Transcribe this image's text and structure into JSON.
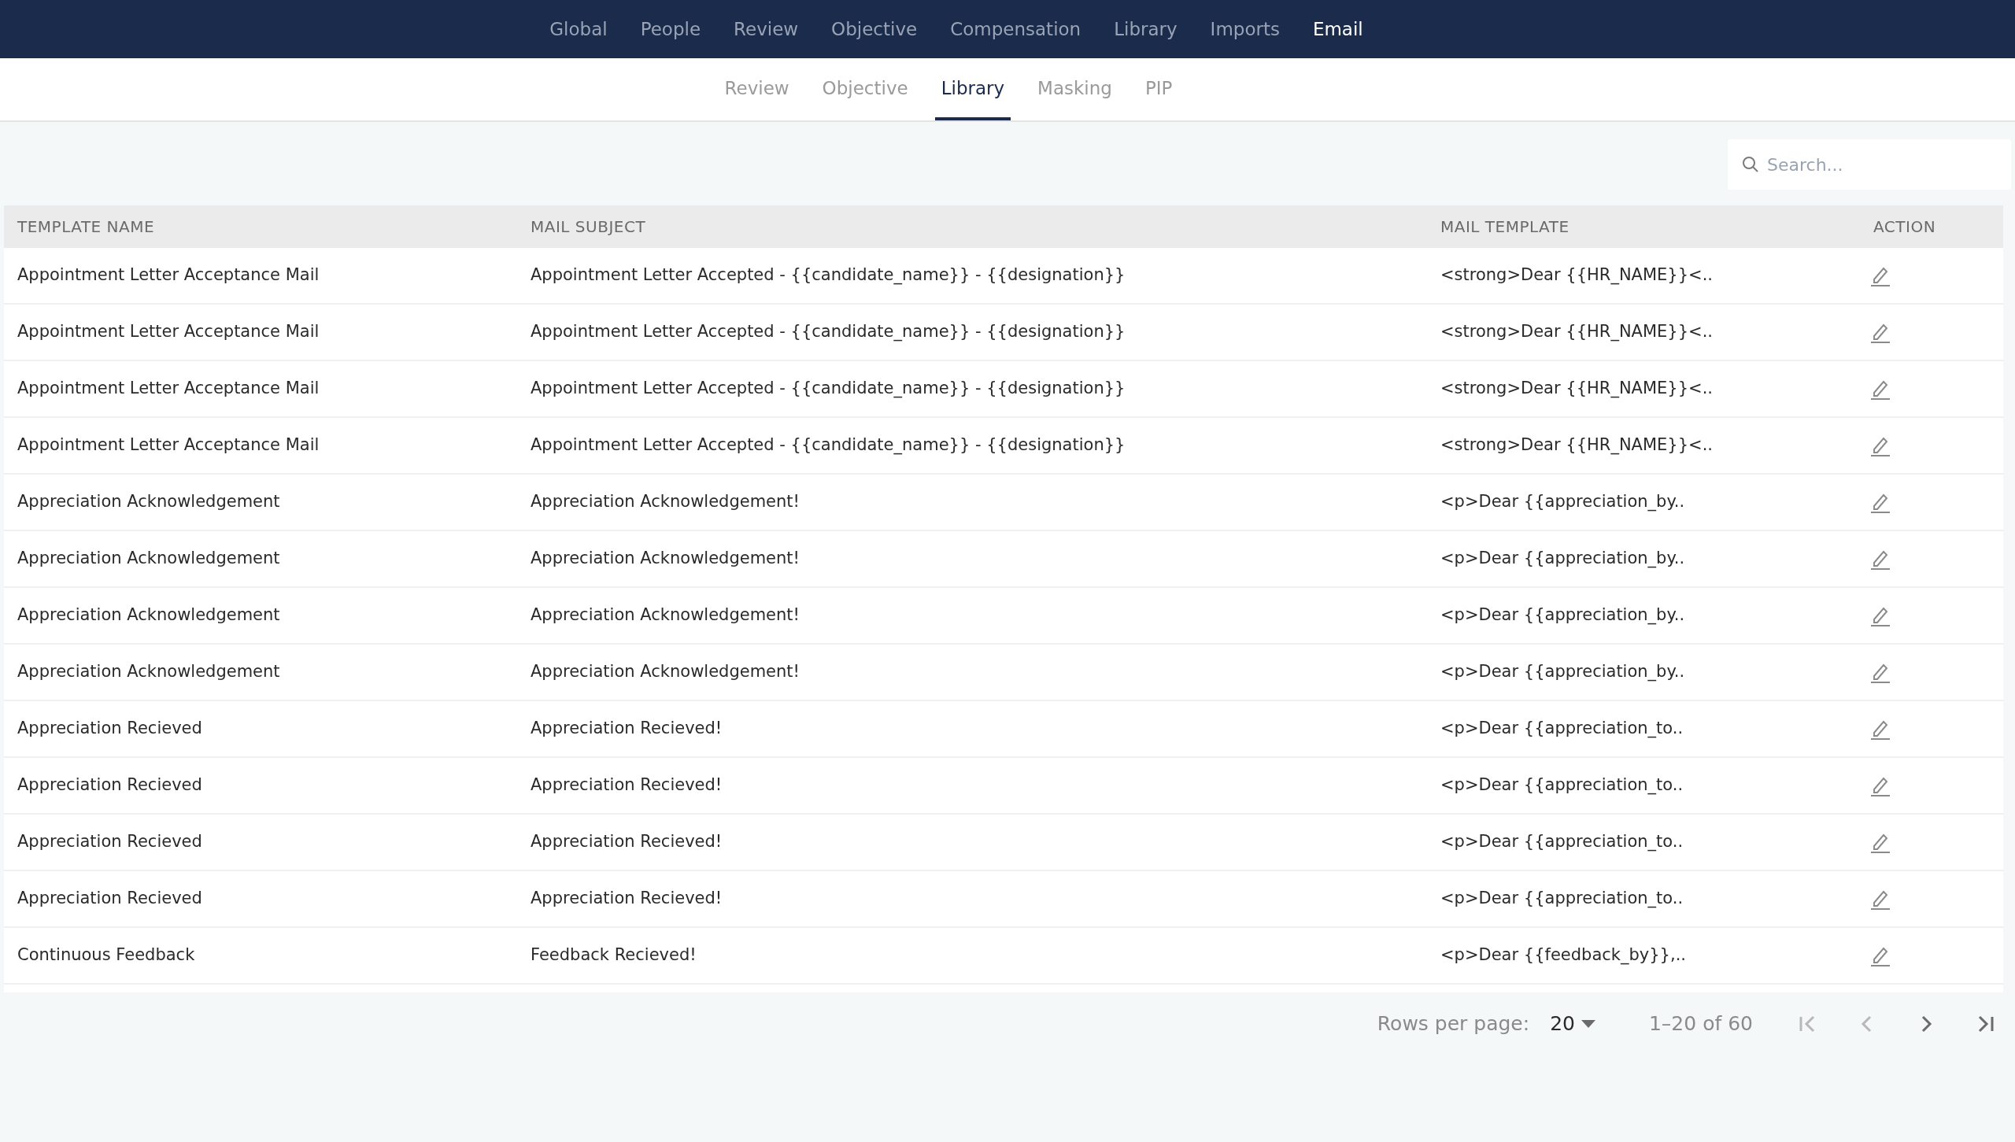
{
  "top_nav": [
    {
      "label": "Global",
      "selected": false
    },
    {
      "label": "People",
      "selected": false
    },
    {
      "label": "Review",
      "selected": false
    },
    {
      "label": "Objective",
      "selected": false
    },
    {
      "label": "Compensation",
      "selected": false
    },
    {
      "label": "Library",
      "selected": false
    },
    {
      "label": "Imports",
      "selected": false
    },
    {
      "label": "Email",
      "selected": true
    }
  ],
  "sub_tabs": [
    {
      "label": "Review",
      "selected": false
    },
    {
      "label": "Objective",
      "selected": false
    },
    {
      "label": "Library",
      "selected": true
    },
    {
      "label": "Masking",
      "selected": false
    },
    {
      "label": "PIP",
      "selected": false
    }
  ],
  "search": {
    "placeholder": "Search..."
  },
  "table": {
    "columns": [
      "TEMPLATE NAME",
      "MAIL SUBJECT",
      "MAIL TEMPLATE",
      "ACTION"
    ],
    "rows": [
      {
        "name": "Appointment Letter Acceptance Mail",
        "subject": "Appointment Letter Accepted - {{candidate_name}} - {{designation}}",
        "template": "<strong>Dear {{HR_NAME}}<.."
      },
      {
        "name": "Appointment Letter Acceptance Mail",
        "subject": "Appointment Letter Accepted - {{candidate_name}} - {{designation}}",
        "template": "<strong>Dear {{HR_NAME}}<.."
      },
      {
        "name": "Appointment Letter Acceptance Mail",
        "subject": "Appointment Letter Accepted - {{candidate_name}} - {{designation}}",
        "template": "<strong>Dear {{HR_NAME}}<.."
      },
      {
        "name": "Appointment Letter Acceptance Mail",
        "subject": "Appointment Letter Accepted - {{candidate_name}} - {{designation}}",
        "template": "<strong>Dear {{HR_NAME}}<.."
      },
      {
        "name": "Appreciation Acknowledgement",
        "subject": "Appreciation Acknowledgement!",
        "template": "<p>Dear {{appreciation_by.."
      },
      {
        "name": "Appreciation Acknowledgement",
        "subject": "Appreciation Acknowledgement!",
        "template": "<p>Dear {{appreciation_by.."
      },
      {
        "name": "Appreciation Acknowledgement",
        "subject": "Appreciation Acknowledgement!",
        "template": "<p>Dear {{appreciation_by.."
      },
      {
        "name": "Appreciation Acknowledgement",
        "subject": "Appreciation Acknowledgement!",
        "template": "<p>Dear {{appreciation_by.."
      },
      {
        "name": "Appreciation Recieved",
        "subject": "Appreciation Recieved!",
        "template": "<p>Dear {{appreciation_to.."
      },
      {
        "name": "Appreciation Recieved",
        "subject": "Appreciation Recieved!",
        "template": "<p>Dear {{appreciation_to.."
      },
      {
        "name": "Appreciation Recieved",
        "subject": "Appreciation Recieved!",
        "template": "<p>Dear {{appreciation_to.."
      },
      {
        "name": "Appreciation Recieved",
        "subject": "Appreciation Recieved!",
        "template": "<p>Dear {{appreciation_to.."
      },
      {
        "name": "Continuous Feedback",
        "subject": "Feedback Recieved!",
        "template": "<p>Dear {{feedback_by}},.."
      }
    ]
  },
  "pagination": {
    "rows_per_page_label": "Rows per page:",
    "rows_per_page": "20",
    "range": "1–20 of 60",
    "first_disabled": true,
    "prev_disabled": true,
    "next_disabled": false,
    "last_disabled": false
  }
}
